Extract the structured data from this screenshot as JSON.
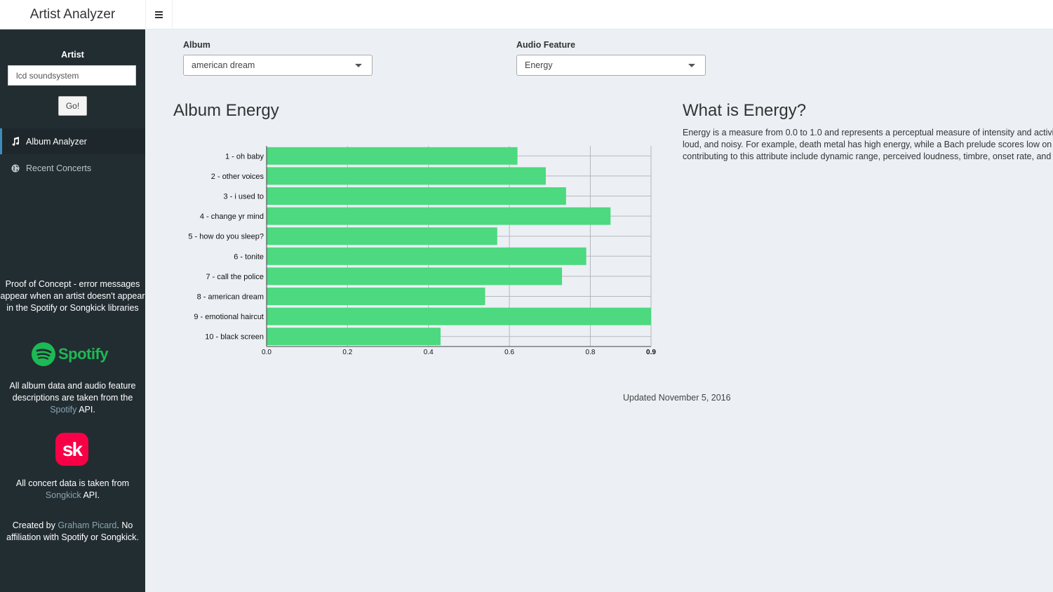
{
  "header": {
    "app_title": "Artist Analyzer",
    "menu_toggle_icon": "hamburger-icon"
  },
  "sidebar": {
    "artist_label": "Artist",
    "artist_value": "lcd soundsystem",
    "go_label": "Go!",
    "menu": [
      {
        "label": "Album Analyzer",
        "icon": "music-note-icon",
        "active": true
      },
      {
        "label": "Recent Concerts",
        "icon": "globe-icon",
        "active": false
      }
    ],
    "poc_note": "Proof of Concept - error messages appear when an artist doesn't appear in the Spotify or Songkick libraries",
    "spotify_logo_text": "Spotify",
    "spotify_note_pre": "All album data and audio feature descriptions are taken from the ",
    "spotify_link": "Spotify",
    "spotify_note_post": " API.",
    "songkick_logo_text": "sk",
    "songkick_note_pre": "All concert data is taken from ",
    "songkick_link": "Songkick",
    "songkick_note_post": " API.",
    "credit_pre": "Created by ",
    "credit_link": "Graham Picard",
    "credit_post": ". No affiliation with Spotify or Songkick."
  },
  "controls": {
    "album_label": "Album",
    "album_value": "american dream",
    "feature_label": "Audio Feature",
    "feature_value": "Energy"
  },
  "chart_title": "Album Energy",
  "info": {
    "title": "What is Energy?",
    "lines": [
      "Energy is a measure from 0.0 to 1.0 and represents a perceptual measure of intensity and activity. Typically, energetic tracks feel fast,",
      "loud, and noisy. For example, death metal has high energy, while a Bach prelude scores low on the scale. Perceptual features",
      "contributing to this attribute include dynamic range, perceived loudness, timbre, onset rate, and general entropy."
    ]
  },
  "updated": "Updated November 5, 2016",
  "colors": {
    "bar": "#4cd97f",
    "sidebar": "#222d32",
    "content_bg": "#ecf0f5"
  },
  "chart_data": {
    "type": "bar",
    "orientation": "horizontal",
    "categories": [
      "1 - oh baby",
      "2 - other voices",
      "3 - i used to",
      "4 - change yr mind",
      "5 - how do you sleep?",
      "6 - tonite",
      "7 - call the police",
      "8 - american dream",
      "9 - emotional haircut",
      "10 - black screen"
    ],
    "values": [
      0.62,
      0.69,
      0.74,
      0.85,
      0.57,
      0.79,
      0.73,
      0.54,
      0.95,
      0.43
    ],
    "xlim": [
      0,
      0.95
    ],
    "xticks": [
      {
        "value": 0.0,
        "label": "0.0"
      },
      {
        "value": 0.2,
        "label": "0.2"
      },
      {
        "value": 0.4,
        "label": "0.4"
      },
      {
        "value": 0.6,
        "label": "0.6"
      },
      {
        "value": 0.8,
        "label": "0.8"
      },
      {
        "value": 0.95,
        "label": "0.9"
      }
    ],
    "grid": true
  }
}
